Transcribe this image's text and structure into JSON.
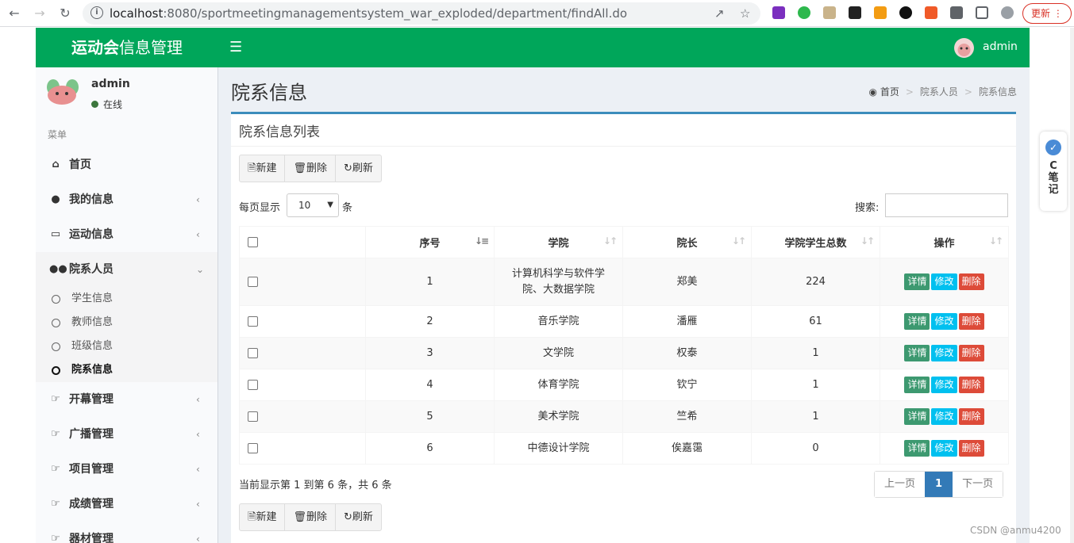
{
  "browser": {
    "url_host": "localhost",
    "url_rest": ":8080/sportmeetingmanagementsystem_war_exploded/department/findAll.do",
    "update_label": "更新"
  },
  "header": {
    "logo_bold": "运动会",
    "logo_rest": "信息管理",
    "user": "admin"
  },
  "sidebar": {
    "user": "admin",
    "status": "在线",
    "header": "菜单",
    "items": [
      {
        "label": "首页",
        "icon": "home-icon"
      },
      {
        "label": "我的信息",
        "icon": "user-icon"
      },
      {
        "label": "运动信息",
        "icon": "bar-chart-icon"
      },
      {
        "label": "院系人员",
        "icon": "users-icon"
      },
      {
        "label": "开幕管理",
        "icon": "thumbs-up-icon"
      },
      {
        "label": "广播管理",
        "icon": "thumbs-up-icon"
      },
      {
        "label": "项目管理",
        "icon": "thumbs-up-icon"
      },
      {
        "label": "成绩管理",
        "icon": "thumbs-up-icon"
      },
      {
        "label": "器材管理",
        "icon": "thumbs-up-icon"
      }
    ],
    "subitems": [
      "学生信息",
      "教师信息",
      "班级信息",
      "院系信息"
    ]
  },
  "content": {
    "title": "院系信息",
    "breadcrumb": [
      "首页",
      "院系人员",
      "院系信息"
    ],
    "box_title": "院系信息列表",
    "toolbar": {
      "new": "新建",
      "delete": "删除",
      "refresh": "刷新"
    },
    "length_prefix": "每页显示",
    "length_value": "10",
    "length_suffix": "条",
    "search_label": "搜索:",
    "columns": [
      "序号",
      "学院",
      "院长",
      "学院学生总数",
      "操作"
    ],
    "rows": [
      {
        "no": "1",
        "college": "计算机科学与软件学院、大数据学院",
        "dean": "郑美",
        "total": "224"
      },
      {
        "no": "2",
        "college": "音乐学院",
        "dean": "潘雁",
        "total": "61"
      },
      {
        "no": "3",
        "college": "文学院",
        "dean": "权泰",
        "total": "1"
      },
      {
        "no": "4",
        "college": "体育学院",
        "dean": "钦宁",
        "total": "1"
      },
      {
        "no": "5",
        "college": "美术学院",
        "dean": "竺希",
        "total": "1"
      },
      {
        "no": "6",
        "college": "中德设计学院",
        "dean": "俟嘉霭",
        "total": "0"
      }
    ],
    "actions": {
      "detail": "详情",
      "edit": "修改",
      "delete": "删除"
    },
    "info": "当前显示第 1 到第 6 条，共 6 条",
    "pager": {
      "prev": "上一页",
      "current": "1",
      "next": "下一页"
    }
  },
  "side_note": {
    "c": "C",
    "l1": "笔",
    "l2": "记"
  },
  "watermark": "CSDN @anmu4200"
}
